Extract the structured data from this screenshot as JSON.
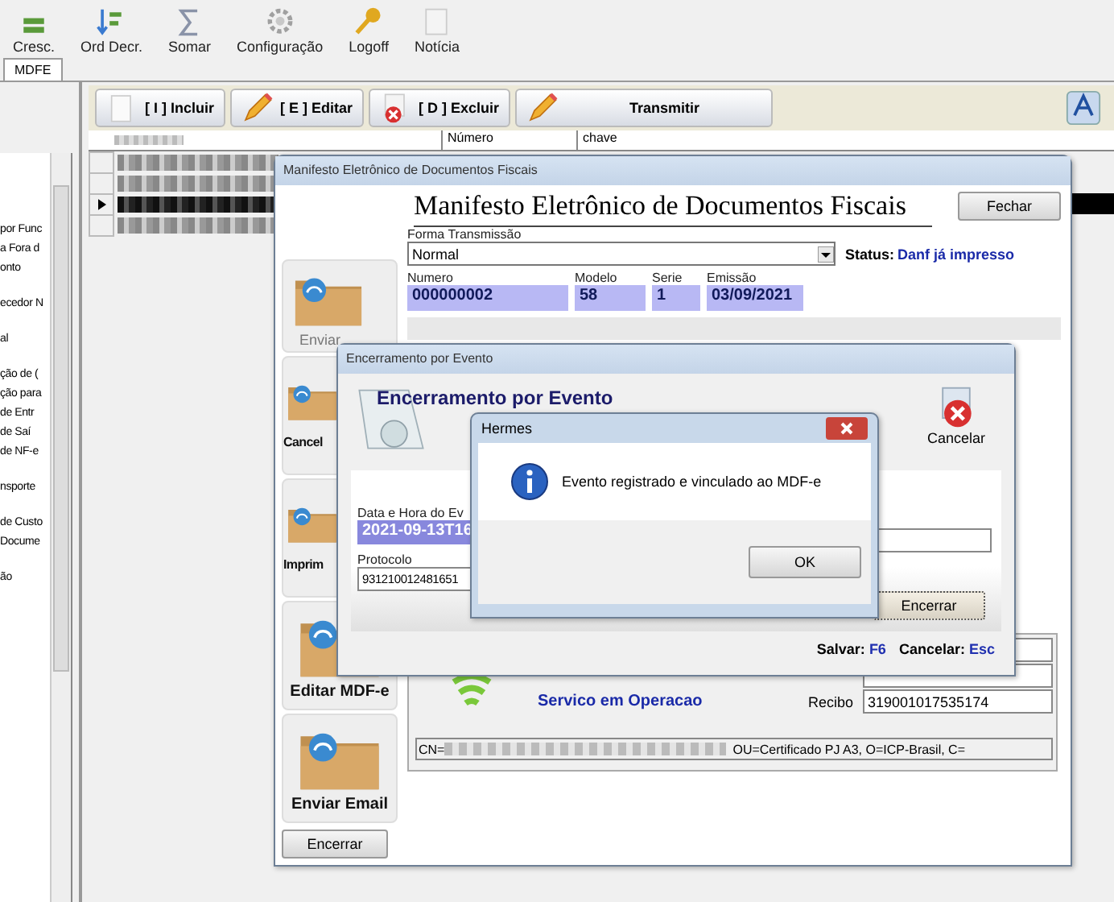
{
  "toolbar": {
    "buttons": [
      {
        "label": "Cresc.",
        "kind": "sort-asc"
      },
      {
        "label": "Ord Decr.",
        "kind": "sort-desc"
      },
      {
        "label": "Somar",
        "kind": "sum"
      },
      {
        "label": "Configuração",
        "kind": "gear"
      },
      {
        "label": "Logoff",
        "kind": "key"
      },
      {
        "label": "Notícia",
        "kind": "mail"
      }
    ]
  },
  "tabs": [
    {
      "label": "MDFE",
      "selected": true
    }
  ],
  "sidebar": {
    "groups": [
      [
        "por Func",
        "a Fora d",
        "onto"
      ],
      [
        "ecedor N"
      ],
      [
        "al"
      ],
      [
        "ção de (",
        "ção para",
        "de Entr",
        "de Saí",
        "de NF-e"
      ],
      [
        "nsporte"
      ],
      [
        "de Custo",
        "Docume"
      ],
      [
        "ão"
      ]
    ]
  },
  "actions": [
    {
      "label": "[ I ] Incluir",
      "kind": "doc"
    },
    {
      "label": "[ E ] Editar",
      "kind": "pencil"
    },
    {
      "label": "[ D ] Excluir",
      "kind": "delete"
    },
    {
      "label": "Transmitir",
      "kind": "pencil"
    }
  ],
  "grid": {
    "columns": [
      "Número",
      "chave"
    ],
    "rows": [
      {
        "selected": false
      },
      {
        "selected": false
      },
      {
        "selected": true
      },
      {
        "selected": false
      }
    ]
  },
  "mdfe_window": {
    "title": "Manifesto Eletrônico de Documentos Fiscais",
    "heading": "Manifesto Eletrônico de Documentos Fiscais",
    "close_button": "Fechar",
    "forma_label": "Forma Transmissão",
    "forma_value": "Normal",
    "status_label": "Status:",
    "status_value": "Danf já impresso",
    "fields": [
      {
        "label": "Numero",
        "value": "000000002"
      },
      {
        "label": "Modelo",
        "value": "58"
      },
      {
        "label": "Serie",
        "value": "1"
      },
      {
        "label": "Emissão",
        "value": "03/09/2021"
      }
    ],
    "side_actions": [
      {
        "label": "Enviar"
      },
      {
        "label": "Cancel"
      },
      {
        "label": "Imprim"
      },
      {
        "label": "Editar MDF-e"
      },
      {
        "label": "Enviar Email"
      }
    ],
    "encerrar_button": "Encerrar",
    "service_status": "Servico em Operacao",
    "recibo_label": "Recibo",
    "recibo_value": "319001017535174",
    "certificate_prefix": "CN=",
    "certificate_suffix": "OU=Certificado PJ A3, O=ICP-Brasil, C="
  },
  "encerramento_dialog": {
    "title": "Encerramento por Evento",
    "heading": "Encerramento por Evento",
    "cancel_label": "Cancelar",
    "datetime_label": "Data e Hora do Ev",
    "datetime_value": "2021-09-13T16",
    "protocolo_label": "Protocolo",
    "protocolo_value": "931210012481651",
    "encerrar_button": "Encerrar",
    "shortcuts": [
      {
        "label": "Salvar:",
        "key": "F6"
      },
      {
        "label": "Cancelar:",
        "key": "Esc"
      }
    ]
  },
  "message_box": {
    "title": "Hermes",
    "message": "Evento registrado e vinculado ao MDF-e",
    "ok_button": "OK"
  }
}
